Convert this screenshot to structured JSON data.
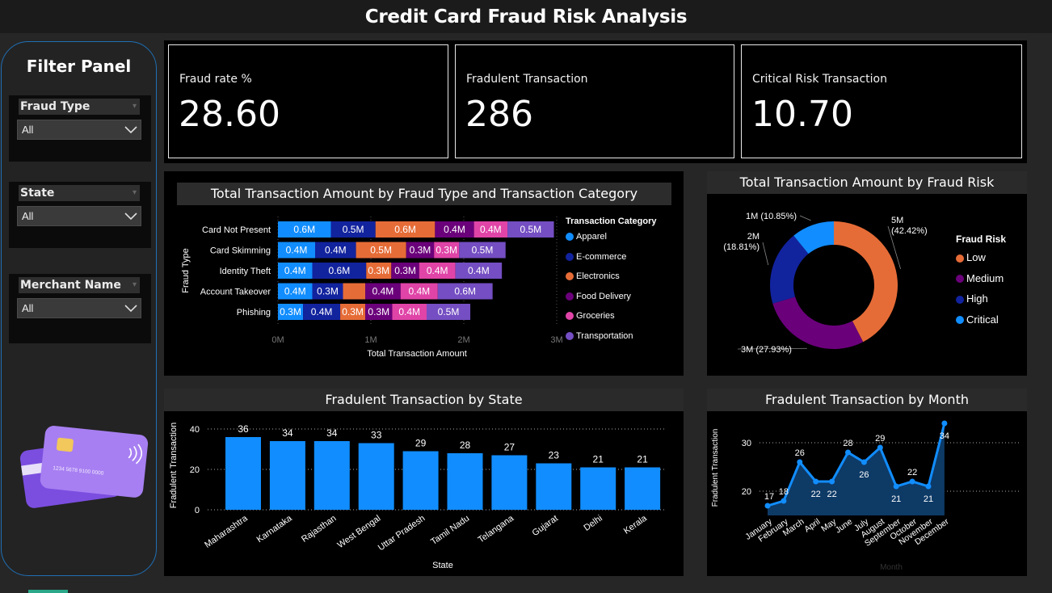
{
  "page_title": "Credit Card Fraud Risk Analysis",
  "filter_panel": {
    "title": "Filter Panel",
    "slicers": [
      {
        "label": "Fraud Type",
        "value": "All"
      },
      {
        "label": "State",
        "value": "All"
      },
      {
        "label": "Merchant Name",
        "value": "All"
      }
    ],
    "card_number": "1234 5678 9100 0000"
  },
  "kpis": [
    {
      "label": "Fraud rate %",
      "value": "28.60"
    },
    {
      "label": "Fradulent Transaction",
      "value": "286"
    },
    {
      "label": "Critical Risk Transaction",
      "value": "10.70"
    }
  ],
  "colors": {
    "apparel": "#118dff",
    "ecommerce": "#12239e",
    "electronics": "#e66c37",
    "food": "#6b007b",
    "groceries": "#e044a7",
    "transportation": "#744ec2",
    "critical": "#118dff",
    "bar": "#118dff"
  },
  "chart_data": [
    {
      "type": "bar",
      "orientation": "horizontal",
      "stacked": true,
      "title": "Total Transaction Amount by Fraud Type and Transaction Category",
      "xlabel": "Total Transaction Amount",
      "ylabel": "Fraud Type",
      "xticks": [
        "0M",
        "1M",
        "2M",
        "3M"
      ],
      "xlim": [
        0,
        3
      ],
      "legend_title": "Transaction Category",
      "categories": [
        "Card Not Present",
        "Card Skimming",
        "Identity Theft",
        "Account Takeover",
        "Phishing"
      ],
      "series": [
        {
          "name": "Apparel",
          "values": [
            0.57,
            0.4,
            0.37,
            0.37,
            0.27
          ]
        },
        {
          "name": "E-commerce",
          "values": [
            0.48,
            0.44,
            0.58,
            0.33,
            0.4
          ]
        },
        {
          "name": "Electronics",
          "values": [
            0.64,
            0.54,
            0.27,
            0.24,
            0.27
          ]
        },
        {
          "name": "Food Delivery",
          "values": [
            0.42,
            0.3,
            0.3,
            0.38,
            0.29
          ]
        },
        {
          "name": "Groceries",
          "values": [
            0.36,
            0.27,
            0.39,
            0.4,
            0.37
          ]
        },
        {
          "name": "Transportation",
          "values": [
            0.5,
            0.5,
            0.5,
            0.59,
            0.47
          ]
        }
      ],
      "data_labels": [
        [
          "0.6M",
          "0.5M",
          "0.6M",
          "0.4M",
          "0.4M",
          "0.5M"
        ],
        [
          "0.4M",
          "0.4M",
          "0.5M",
          "0.3M",
          "0.3M",
          "0.5M"
        ],
        [
          "0.4M",
          "0.6M",
          "0.3M",
          "0.3M",
          "0.4M",
          "0.4M"
        ],
        [
          "0.4M",
          "0.3M",
          "",
          "0.4M",
          "0.4M",
          "0.6M"
        ],
        [
          "0.3M",
          "0.4M",
          "0.3M",
          "0.3M",
          "0.4M",
          "0.5M"
        ]
      ]
    },
    {
      "type": "pie",
      "donut": true,
      "title": "Total Transaction Amount by Fraud Risk",
      "legend_title": "Fraud Risk",
      "categories": [
        "Low",
        "Medium",
        "High",
        "Critical"
      ],
      "values": [
        5,
        3,
        2,
        1
      ],
      "percents": [
        42.42,
        27.93,
        18.81,
        10.85
      ],
      "labels": [
        "5M (42.42%)",
        "3M (27.93%)",
        "2M (18.81%)",
        "1M (10.85%)"
      ],
      "colors": [
        "#e66c37",
        "#6b007b",
        "#12239e",
        "#118dff"
      ]
    },
    {
      "type": "bar",
      "title": "Fradulent Transaction by State",
      "xlabel": "State",
      "ylabel": "Fradulent Transaction",
      "yticks": [
        "0",
        "20",
        "40"
      ],
      "ylim": [
        0,
        44
      ],
      "categories": [
        "Maharashtra",
        "Karnataka",
        "Rajasthan",
        "West Bengal",
        "Uttar Pradesh",
        "Tamil Nadu",
        "Telangana",
        "Gujarat",
        "Delhi",
        "Kerala"
      ],
      "values": [
        36,
        34,
        34,
        33,
        29,
        28,
        27,
        23,
        21,
        21
      ]
    },
    {
      "type": "area",
      "title": "Fradulent Transaction by Month",
      "xlabel": "Month",
      "ylabel": "Fradulent Transaction",
      "yticks": [
        "20",
        "30"
      ],
      "ylim": [
        14,
        37
      ],
      "categories": [
        "January",
        "February",
        "March",
        "April",
        "May",
        "June",
        "July",
        "August",
        "September",
        "October",
        "November",
        "December"
      ],
      "values": [
        17,
        18,
        26,
        22,
        22,
        28,
        26,
        29,
        21,
        22,
        21,
        34
      ]
    }
  ]
}
